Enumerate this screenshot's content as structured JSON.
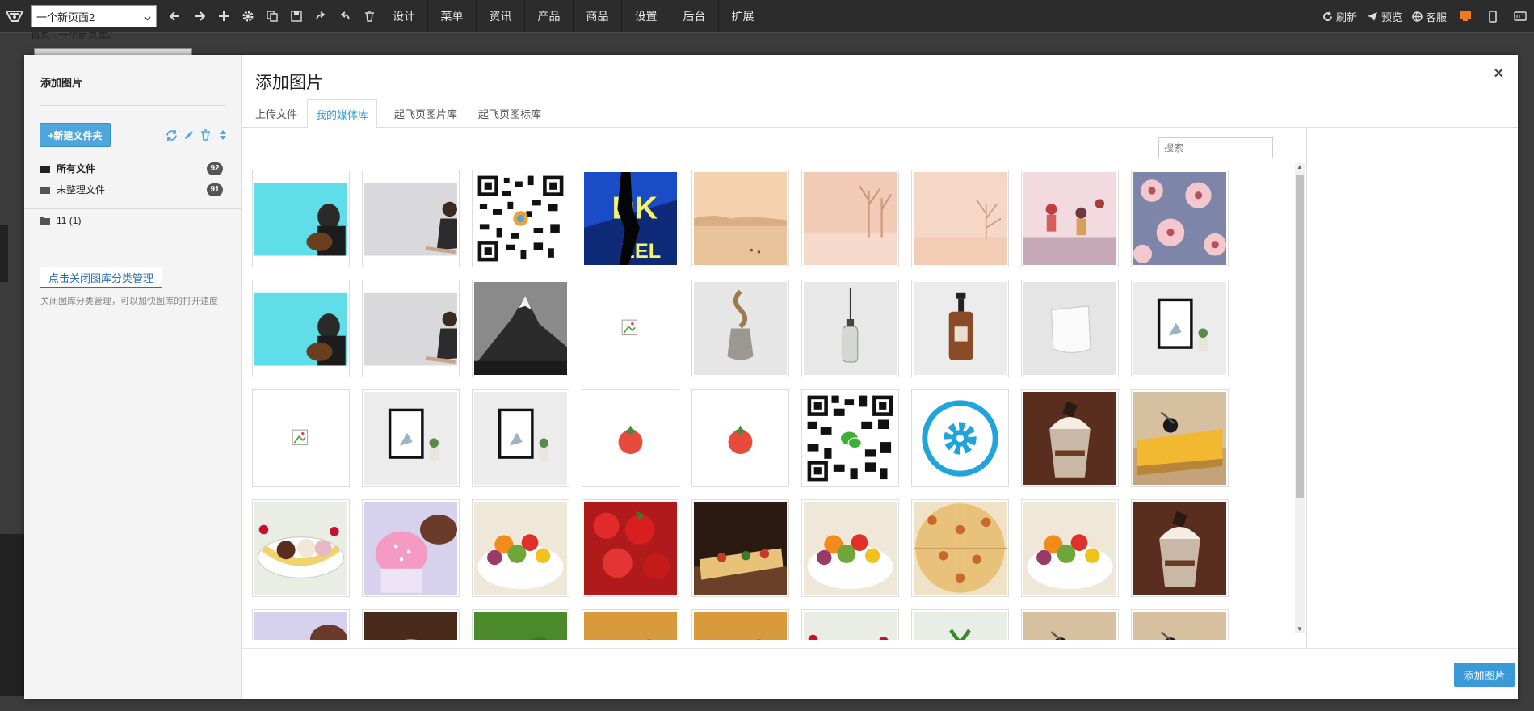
{
  "topbar": {
    "page_select": "一个新页面2",
    "menus": [
      "设计",
      "菜单",
      "资讯",
      "产品",
      "商品",
      "设置",
      "后台",
      "扩展"
    ],
    "refresh": "刷新",
    "preview": "预览",
    "service": "客服"
  },
  "background": {
    "breadcrumb": "首页 - 一个新页面2"
  },
  "modal": {
    "sidebar_title": "添加图片",
    "new_folder": "+新建文件夹",
    "folders": [
      {
        "label": "所有文件",
        "count": "92"
      },
      {
        "label": "未整理文件",
        "count": "91"
      }
    ],
    "user_folder": "11 (1)",
    "close_category": "点击关闭图库分类管理",
    "hint": "关闭图库分类管理，可以加快图库的打开速度",
    "title": "添加图片",
    "close": "×",
    "tabs": [
      "上传文件",
      "我的媒体库",
      "起飞页图片库",
      "起飞页图标库"
    ],
    "active_tab": "我的媒体库",
    "search_placeholder": "搜索",
    "add_button": "添加图片"
  },
  "media_items": [
    "guitar-girl-cyan",
    "girl-sitting-gray",
    "qr-code",
    "music-poster-blue",
    "misty-lake",
    "misty-trees",
    "misty-forest",
    "jumping-friends",
    "floral-pattern",
    "guitar-girl-cyan",
    "girl-sitting-gray",
    "mountain-bw",
    "broken-image",
    "rope-weight",
    "glass-bottle",
    "pump-bottle",
    "paper-bag",
    "frame-plant",
    "broken-image",
    "frame-plant",
    "frame-plant",
    "tomato",
    "tomato",
    "wechat-qr",
    "gear-circle",
    "cream-dessert",
    "cheesecake",
    "banana-split",
    "cupcakes",
    "salad",
    "strawberries",
    "pizza-board",
    "salad",
    "pizza",
    "salad",
    "cream-dessert",
    "cupcakes",
    "rice-bowl",
    "greens",
    "pizza-close",
    "pizza-close",
    "banana-split",
    "soup",
    "cheesecake",
    "cheesecake"
  ],
  "colors": {
    "accent": "#3a9ad9",
    "new_folder_bg": "#4ea6dc",
    "topbar_bg": "#2c2c2c"
  }
}
